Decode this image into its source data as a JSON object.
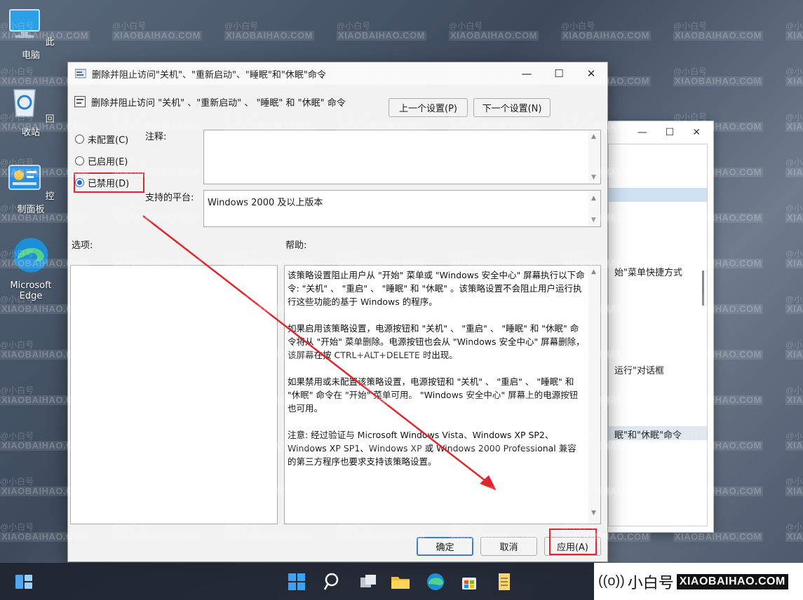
{
  "desktop": {
    "icons": [
      {
        "label": "此电脑",
        "icon": "computer-icon"
      },
      {
        "label": "回收站",
        "icon": "recycle-bin-icon"
      },
      {
        "label": "控制面板",
        "icon": "control-panel-icon"
      },
      {
        "label": "Microsoft Edge",
        "icon": "edge-icon"
      }
    ]
  },
  "watermark": {
    "line1": "@小白号",
    "line2": "XIAOBAIHAO.COM"
  },
  "back_window": {
    "rows": [
      "始\"菜单快捷方式",
      "运行\"对话框",
      "眠\"和\"休眠\"命令"
    ]
  },
  "dialog": {
    "title": "删除并阻止访问\"关机\"、\"重新启动\"、\"睡眠\"和\"休眠\"命令",
    "policy_title": "删除并阻止访问 \"关机\" 、\"重新启动\" 、 \"睡眠\" 和 \"休眠\" 命令",
    "prev_button": "上一个设置(P)",
    "next_button": "下一个设置(N)",
    "options": [
      {
        "label": "未配置(C)",
        "selected": false
      },
      {
        "label": "已启用(E)",
        "selected": false
      },
      {
        "label": "已禁用(D)",
        "selected": true
      }
    ],
    "comment_label": "注释:",
    "comment_value": "",
    "platform_label": "支持的平台:",
    "platform_value": "Windows 2000 及以上版本",
    "options_label": "选项:",
    "help_label": "帮助:",
    "help_paragraphs": [
      "该策略设置阻止用户从 \"开始\" 菜单或 \"Windows 安全中心\" 屏幕执行以下命令: \"关机\" 、 \"重启\" 、 \"睡眠\" 和 \"休眠\" 。该策略设置不会阻止用户运行执行这些功能的基于 Windows 的程序。",
      "如果启用该策略设置，电源按钮和 \"关机\" 、 \"重启\" 、 \"睡眠\" 和 \"休眠\" 命令将从 \"开始\" 菜单删除。电源按钮也会从 \"Windows 安全中心\" 屏幕删除，该屏幕在按 CTRL+ALT+DELETE 时出现。",
      "如果禁用或未配置该策略设置，电源按钮和 \"关机\" 、 \"重启\" 、 \"睡眠\" 和 \"休眠\" 命令在 \"开始\" 菜单可用。 \"Windows 安全中心\" 屏幕上的电源按钮也可用。",
      "注意: 经过验证与 Microsoft Windows Vista、Windows XP SP2、Windows XP SP1、Windows XP 或 Windows 2000 Professional 兼容的第三方程序也要求支持该策略设置。"
    ],
    "ok_button": "确定",
    "cancel_button": "取消",
    "apply_button": "应用(A)"
  },
  "taskbar": {
    "icons": [
      "widgets-icon",
      "start-icon",
      "search-icon",
      "task-view-icon",
      "file-explorer-icon",
      "edge-icon",
      "store-icon",
      "notepad-icon"
    ]
  },
  "logo": {
    "signal": "((o))",
    "name": "小白号",
    "domain": "XIAOBAIHAO.COM"
  },
  "colors": {
    "accent": "#1f6fd6",
    "highlight_red": "#e0262c"
  }
}
